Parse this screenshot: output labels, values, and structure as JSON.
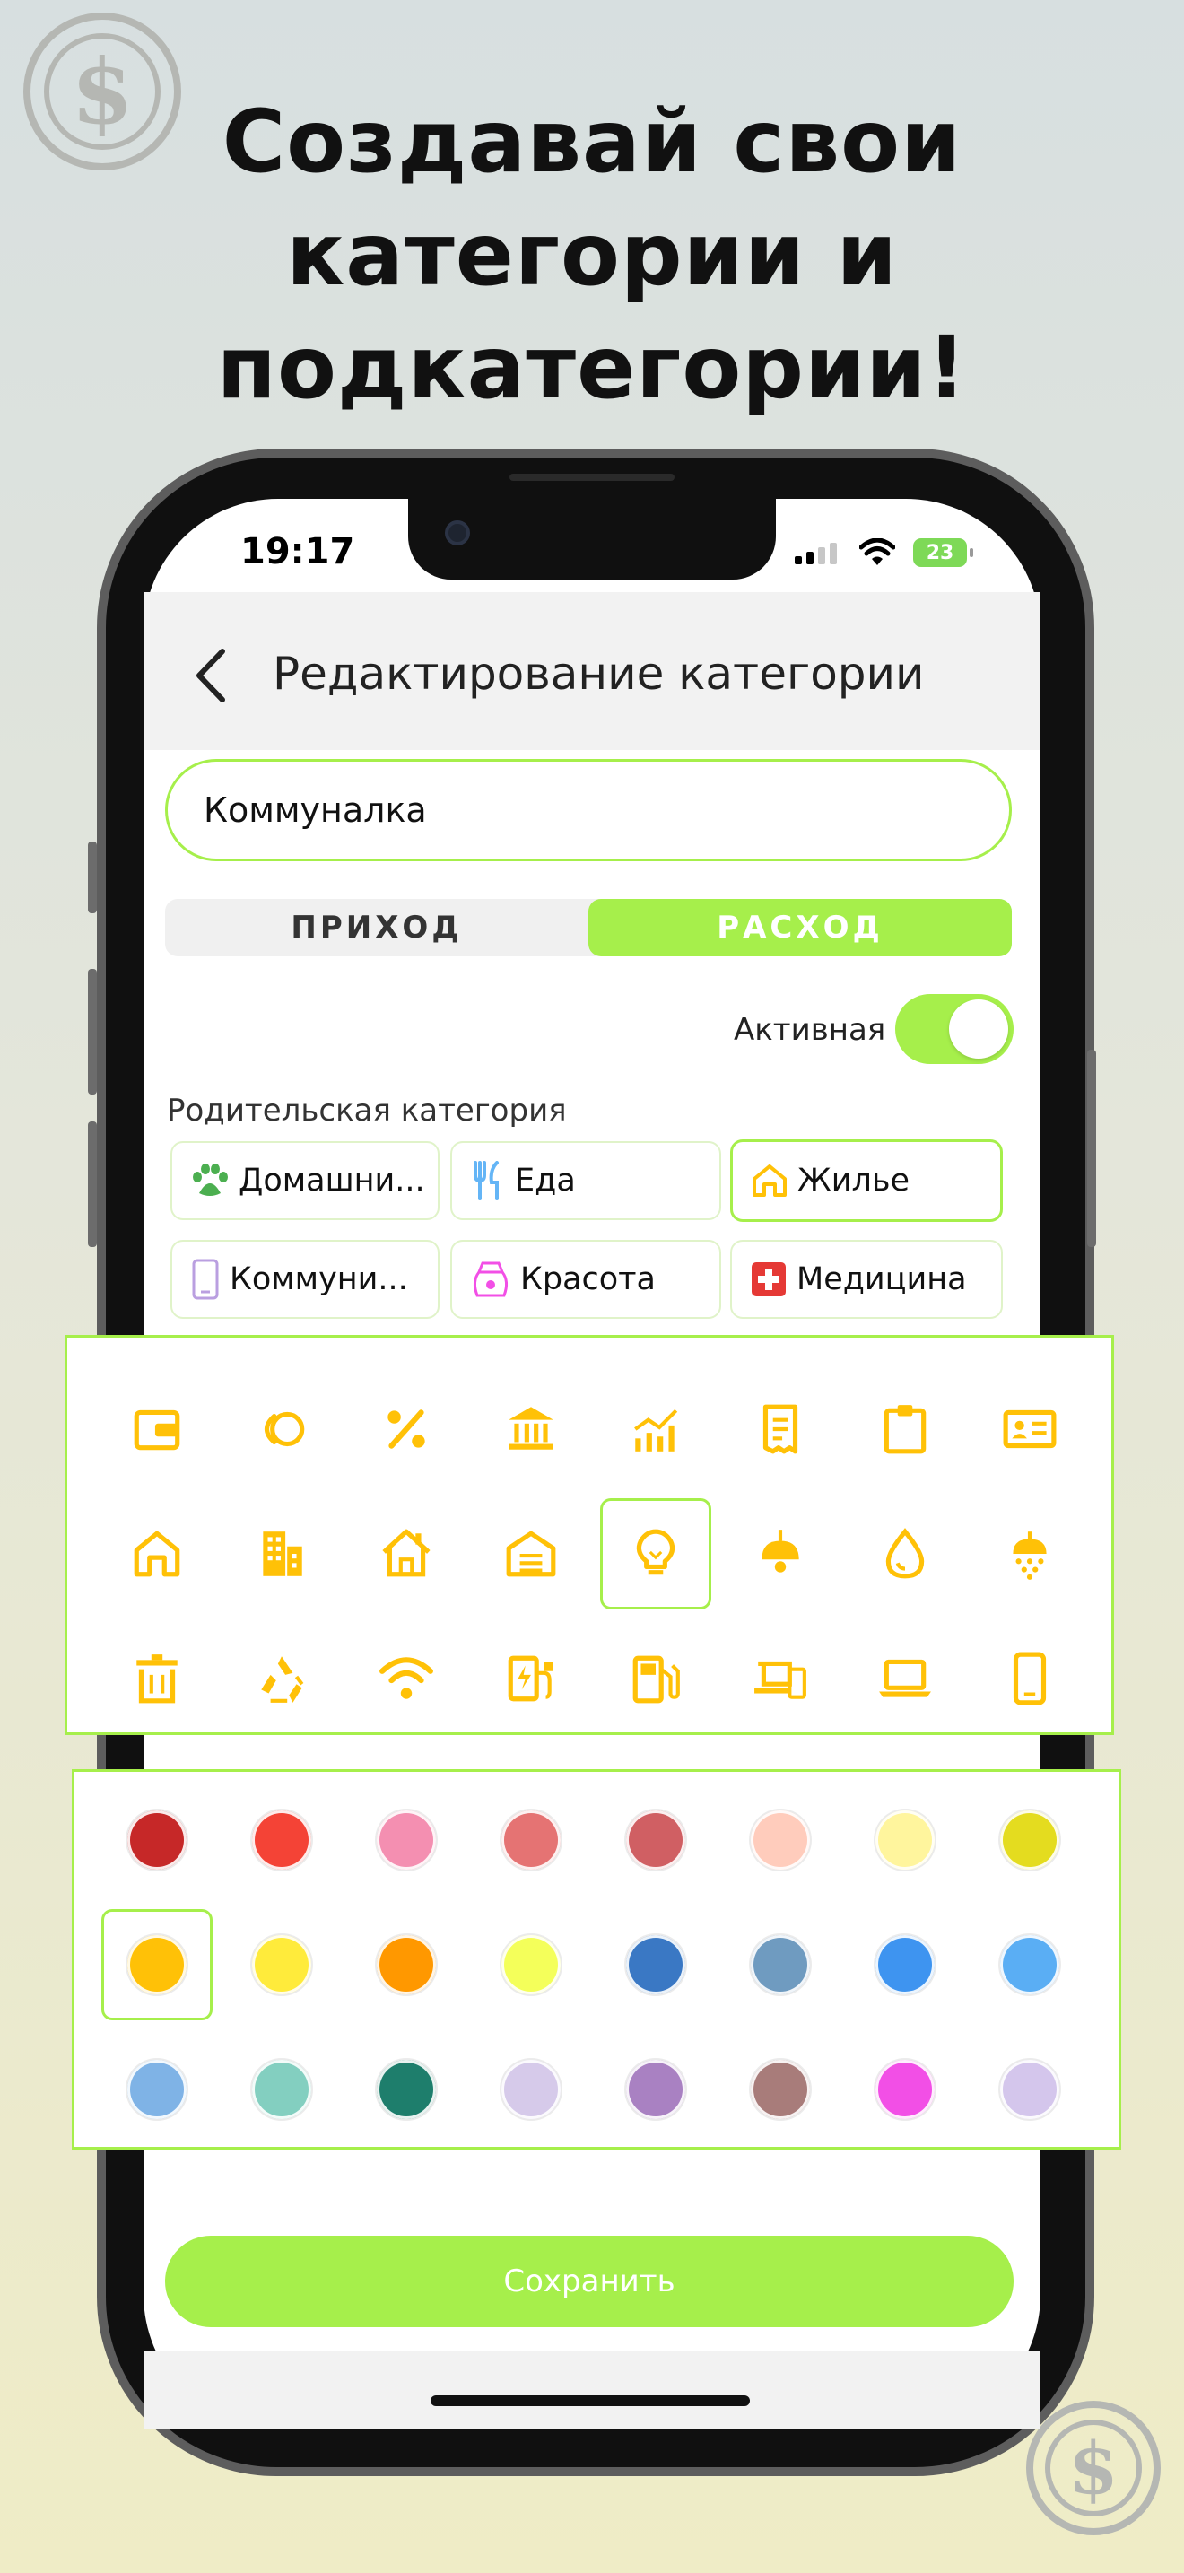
{
  "headline": [
    "Создавай свои",
    "категории и",
    "подкатегории!"
  ],
  "logo_symbol": "$",
  "status_bar": {
    "time": "19:17",
    "battery": "23"
  },
  "header": {
    "back_icon": "chevron-left-icon",
    "title": "Редактирование категории"
  },
  "form": {
    "name_value": "Коммуналка",
    "type_tabs": [
      "ПРИХОД",
      "РАСХОД"
    ],
    "type_selected": "РАСХОД",
    "active_label": "Активная",
    "active_on": true,
    "parent_label": "Родительская категория",
    "parent_categories": [
      {
        "label": "Домашни...",
        "icon": "paw-icon",
        "selected": false
      },
      {
        "label": "Еда",
        "icon": "fork-knife-icon",
        "selected": false
      },
      {
        "label": "Жилье",
        "icon": "house-icon",
        "selected": true
      },
      {
        "label": "Коммуни...",
        "icon": "phone-icon",
        "selected": false
      },
      {
        "label": "Красота",
        "icon": "cosmetics-icon",
        "selected": false
      },
      {
        "label": "Медицина",
        "icon": "medical-cross-icon",
        "selected": false
      }
    ]
  },
  "icon_picker": {
    "accent": "#FFC107",
    "selected_index": 12,
    "icons": [
      "wallet-icon",
      "coins-icon",
      "percent-icon",
      "bank-icon",
      "growth-chart-icon",
      "receipt-icon",
      "clipboard-icon",
      "id-card-icon",
      "house-icon",
      "buildings-icon",
      "house-roof-icon",
      "garage-icon",
      "lightbulb-icon",
      "ceiling-lamp-icon",
      "water-drop-icon",
      "shower-icon",
      "trash-bin-icon",
      "recycle-icon",
      "wifi-icon",
      "ev-charger-icon",
      "fuel-pump-icon",
      "devices-icon",
      "laptop-icon",
      "smartphone-icon"
    ]
  },
  "color_picker": {
    "selected_index": 8,
    "colors": [
      "#C62828",
      "#F44336",
      "#F48FB1",
      "#E57373",
      "#D05F63",
      "#FFCCBC",
      "#FFF59D",
      "#E4DC1F",
      "#FFC107",
      "#FFEB3B",
      "#FF9800",
      "#F4FF5A",
      "#3A78C4",
      "#6F9BC0",
      "#3E94F0",
      "#5AAEF4",
      "#7FB3E6",
      "#83CFC0",
      "#1E7E6C",
      "#D6CAEA",
      "#A981C2",
      "#A87C7A",
      "#F24FE6",
      "#D4C6EC"
    ]
  },
  "save_label": "Сохранить"
}
